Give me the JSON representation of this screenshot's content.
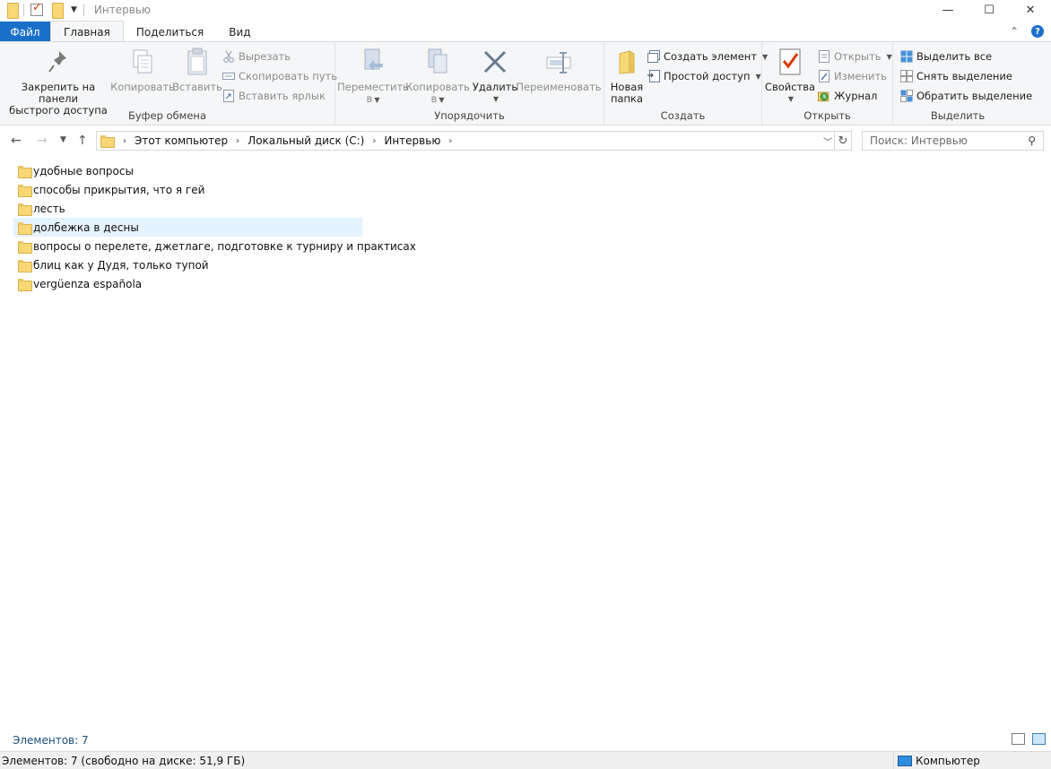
{
  "window": {
    "title": "Интервью",
    "minimize": "—",
    "maximize": "☐",
    "close": "✕"
  },
  "tabs": {
    "file": "Файл",
    "home": "Главная",
    "share": "Поделиться",
    "view": "Вид"
  },
  "ribbon": {
    "clipboard": {
      "label": "Буфер обмена",
      "pin_line1": "Закрепить на панели",
      "pin_line2": "быстрого доступа",
      "copy": "Копировать",
      "paste": "Вставить",
      "cut": "Вырезать",
      "copy_path": "Скопировать путь",
      "paste_shortcut": "Вставить ярлык"
    },
    "organize": {
      "label": "Упорядочить",
      "move_line1": "Переместить",
      "move_line2": "в",
      "copy_line1": "Копировать",
      "copy_line2": "в",
      "delete": "Удалить",
      "rename": "Переименовать"
    },
    "create": {
      "label": "Создать",
      "new_folder_line1": "Новая",
      "new_folder_line2": "папка",
      "new_item": "Создать элемент",
      "easy_access": "Простой доступ"
    },
    "open": {
      "label": "Открыть",
      "properties": "Свойства",
      "open": "Открыть",
      "edit": "Изменить",
      "history": "Журнал"
    },
    "select": {
      "label": "Выделить",
      "select_all": "Выделить все",
      "select_none": "Снять выделение",
      "invert": "Обратить выделение"
    }
  },
  "address": {
    "crumbs": [
      "Этот компьютер",
      "Локальный диск (C:)",
      "Интервью"
    ]
  },
  "search": {
    "placeholder": "Поиск: Интервью"
  },
  "files": [
    "удобные вопросы",
    "способы прикрытия, что я гей",
    "лесть",
    "долбежка в десны",
    "вопросы о перелете, джетлаге, подготовке к турниру и практисах",
    "блиц как у Дудя, только тупой",
    "vergüenza española"
  ],
  "status": {
    "count": "Элементов: 7",
    "bottom": "Элементов: 7 (свободно на диске: 51,9 ГБ)",
    "computer": "Компьютер"
  }
}
